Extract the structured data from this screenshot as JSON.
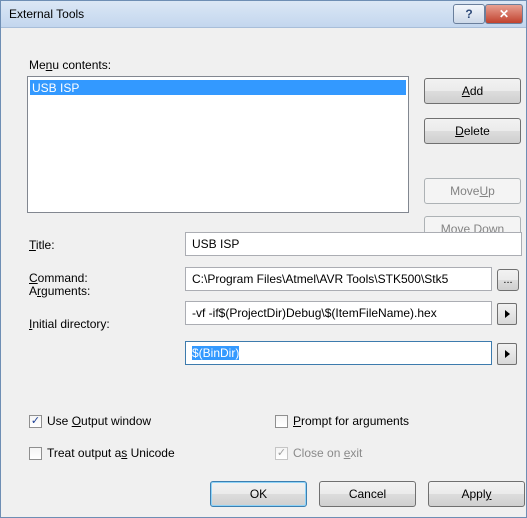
{
  "window": {
    "title": "External Tools",
    "help_label": "?",
    "close_label": "✕"
  },
  "menu_contents": {
    "label_pre": "Me",
    "label_key": "n",
    "label_post": "u contents:",
    "items": [
      "USB ISP"
    ]
  },
  "buttons": {
    "add": {
      "key": "A",
      "rest": "dd"
    },
    "delete": {
      "key": "D",
      "rest": "elete"
    },
    "move_up": {
      "pre": "Move ",
      "key": "U",
      "post": "p"
    },
    "move_down": {
      "pre": "Move Do",
      "key": "w",
      "post": "n"
    },
    "ok": "OK",
    "cancel": "Cancel",
    "apply": {
      "pre": "Appl",
      "key": "y",
      "post": ""
    }
  },
  "title_field": {
    "label_key": "T",
    "label_rest": "itle:",
    "value": "USB ISP"
  },
  "command_field": {
    "label_key": "C",
    "label_rest": "ommand:",
    "value": "C:\\Program Files\\Atmel\\AVR Tools\\STK500\\Stk5",
    "browse_label": "..."
  },
  "arguments_field": {
    "label_pre": "A",
    "label_key": "r",
    "label_post": "guments:",
    "value": "-vf -if$(ProjectDir)Debug\\$(ItemFileName).hex"
  },
  "initial_dir_field": {
    "label_pre": "",
    "label_key": "I",
    "label_post": "nitial directory:",
    "value": "$(BinDir)"
  },
  "options": {
    "use_output": {
      "pre": "Use ",
      "key": "O",
      "post": "utput window",
      "checked": true
    },
    "prompt_args": {
      "pre": "",
      "key": "P",
      "post": "rompt for arguments",
      "checked": false
    },
    "treat_unicode": {
      "pre": "Treat output a",
      "key": "s",
      "post": " Unicode",
      "checked": false
    },
    "close_on_exit": {
      "pre": "Close on ",
      "key": "e",
      "post": "xit",
      "checked": true,
      "enabled": false
    }
  },
  "check_glyph": "✓",
  "colors": {
    "selection": "#3399ff",
    "titlebar": "#c3d6ee",
    "dialog": "#f0f0f0"
  }
}
